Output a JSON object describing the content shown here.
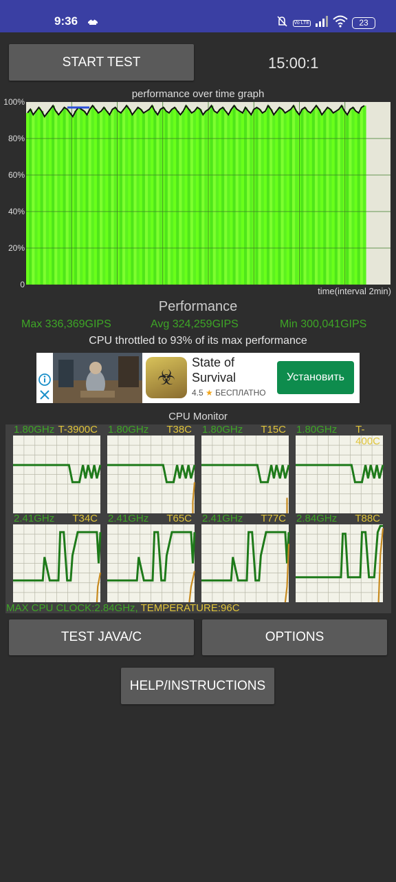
{
  "status_bar": {
    "time": "9:36",
    "battery": "23",
    "icons": [
      "notification-icon",
      "mute-icon",
      "volte-icon",
      "signal-icon",
      "wifi-icon",
      "battery-icon"
    ],
    "volte_text": "Vo LTE"
  },
  "controls": {
    "start_label": "START TEST",
    "timer": "15:00:1",
    "test_java_label": "TEST JAVA/C",
    "options_label": "OPTIONS",
    "help_label": "HELP/INSTRUCTIONS"
  },
  "colors": {
    "status_bar": "#3a3fa3",
    "background": "#2d2d2d",
    "button": "#5a5a5a",
    "accent_green": "#3ea626",
    "temp_yellow": "#e0c43a",
    "graph_fill": "#6aff1a"
  },
  "graph": {
    "title": "performance over time graph",
    "time_label": "time(interval 2min)",
    "y_ticks": [
      "100%",
      "80%",
      "60%",
      "40%",
      "20%",
      "0"
    ]
  },
  "performance": {
    "heading": "Performance",
    "max": "Max 336,369GIPS",
    "avg": "Avg 324,259GIPS",
    "min": "Min 300,041GIPS",
    "throttle": "CPU throttled to 93% of its max performance"
  },
  "ad": {
    "title": "State of Survival",
    "rating": "4.5",
    "price": "БЕСПЛАТНО",
    "install_label": "Установить"
  },
  "cpu_monitor": {
    "title": "CPU Monitor",
    "cores": [
      {
        "freq": "1.80GHz",
        "temp": "T-3900C"
      },
      {
        "freq": "1.80GHz",
        "temp": "T38C"
      },
      {
        "freq": "1.80GHz",
        "temp": "T15C"
      },
      {
        "freq": "1.80GHz",
        "temp": "T-400C"
      },
      {
        "freq": "2.41GHz",
        "temp": "T34C"
      },
      {
        "freq": "2.41GHz",
        "temp": "T65C"
      },
      {
        "freq": "2.41GHz",
        "temp": "T77C"
      },
      {
        "freq": "2.84GHz",
        "temp": "T88C"
      }
    ],
    "footer_clock": "MAX CPU CLOCK:2.84GHz,",
    "footer_temp": "TEMPERATURE:96C"
  },
  "chart_data": {
    "type": "area",
    "title": "performance over time graph",
    "xlabel": "time(interval 2min)",
    "ylabel": "",
    "ylim": [
      0,
      100
    ],
    "y_unit": "%",
    "grid": true,
    "x_gridlines": 7,
    "series": [
      {
        "values": [
          94,
          96,
          93,
          95,
          97,
          95,
          92,
          94,
          96,
          98,
          95,
          93,
          95,
          97,
          96,
          94,
          92,
          95,
          97,
          96,
          95,
          93,
          96,
          98,
          96,
          94,
          95,
          97,
          95,
          93,
          96,
          97,
          95,
          94,
          96,
          98,
          96,
          93,
          95,
          97,
          96,
          94,
          95,
          96,
          98,
          95,
          93,
          96,
          97,
          95,
          94,
          96,
          97,
          95,
          93,
          95,
          98,
          96,
          94,
          95,
          97,
          96,
          93,
          95,
          96,
          98,
          95,
          94,
          96,
          97,
          95,
          93,
          96,
          98,
          96,
          95,
          94,
          97,
          95,
          93,
          96,
          97,
          96,
          94,
          95,
          98,
          96,
          93,
          95,
          97,
          96,
          94,
          95,
          96,
          98,
          95,
          93,
          96,
          97,
          95,
          94,
          96,
          98,
          96,
          93,
          95,
          97,
          96,
          94,
          95,
          96,
          98,
          95,
          93,
          96,
          97,
          95,
          94,
          97,
          98
        ]
      }
    ],
    "avg_marker": 97
  }
}
